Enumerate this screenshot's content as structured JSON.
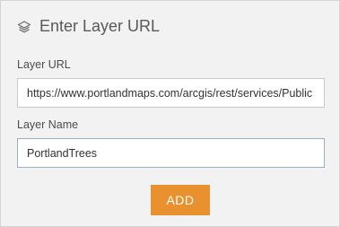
{
  "dialog": {
    "title": "Enter Layer URL",
    "icon": "layers-icon"
  },
  "form": {
    "url_label": "Layer URL",
    "url_value": "https://www.portlandmaps.com/arcgis/rest/services/Public",
    "name_label": "Layer Name",
    "name_value": "PortlandTrees"
  },
  "actions": {
    "add_label": "ADD"
  },
  "colors": {
    "accent": "#e8912e",
    "background": "#f2f2f2"
  }
}
